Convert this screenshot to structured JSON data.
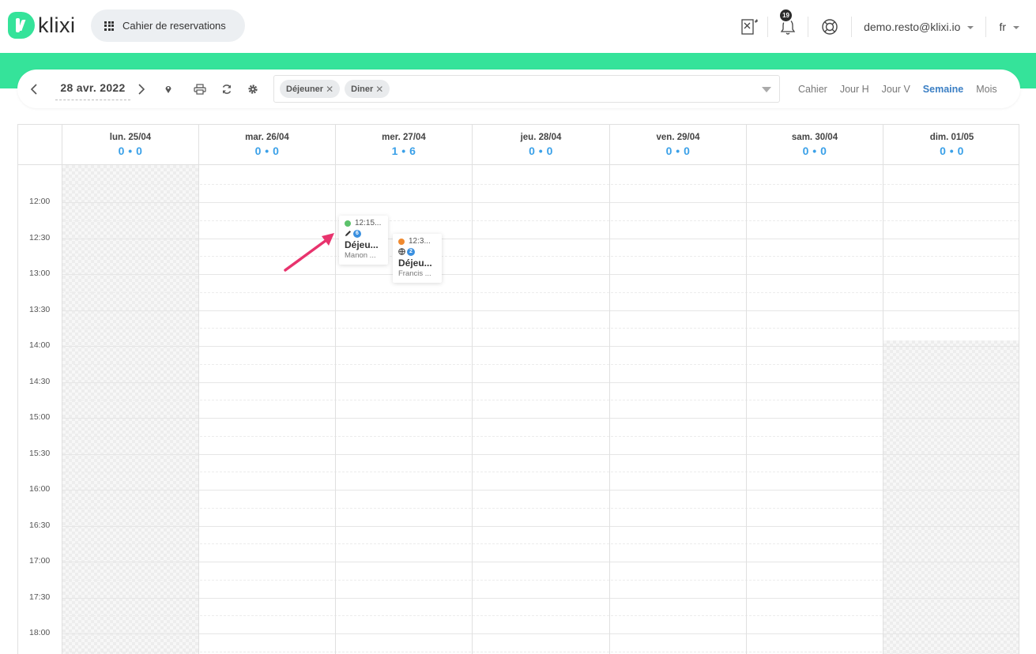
{
  "header": {
    "logo_text": "klixi",
    "app_menu_label": "Cahier de reservations",
    "notifications_count": "19",
    "user_email": "demo.resto@klixi.io",
    "language": "fr"
  },
  "toolbar": {
    "current_date": "28 avr. 2022",
    "filters": [
      "Déjeuner",
      "Diner"
    ],
    "views": [
      "Cahier",
      "Jour H",
      "Jour V",
      "Semaine",
      "Mois"
    ],
    "active_view": "Semaine"
  },
  "calendar": {
    "days": [
      {
        "label": "lun. 25/04",
        "count": "0 • 0"
      },
      {
        "label": "mar. 26/04",
        "count": "0 • 0"
      },
      {
        "label": "mer. 27/04",
        "count": "1 • 6"
      },
      {
        "label": "jeu. 28/04",
        "count": "0 • 0"
      },
      {
        "label": "ven. 29/04",
        "count": "0 • 0"
      },
      {
        "label": "sam. 30/04",
        "count": "0 • 0"
      },
      {
        "label": "dim. 01/05",
        "count": "0 • 0"
      }
    ],
    "hours": [
      "12:00",
      "12:30",
      "13:00",
      "13:30",
      "14:00",
      "14:30",
      "15:00",
      "15:30",
      "16:00",
      "16:30",
      "17:00",
      "17:30",
      "18:00"
    ],
    "events": [
      {
        "time": "12:15...",
        "badge": "6",
        "title": "Déjeu...",
        "name": "Manon ...",
        "status_color": "#5cc26b",
        "source_icon": "pencil-icon"
      },
      {
        "time": "12:3...",
        "badge": "2",
        "title": "Déjeu...",
        "name": "Francis ...",
        "status_color": "#f08a30",
        "source_icon": "globe-icon"
      }
    ]
  },
  "colors": {
    "brand_green": "#35e39a",
    "accent_blue": "#3aa0e8",
    "annotation_arrow": "#e8336d"
  }
}
